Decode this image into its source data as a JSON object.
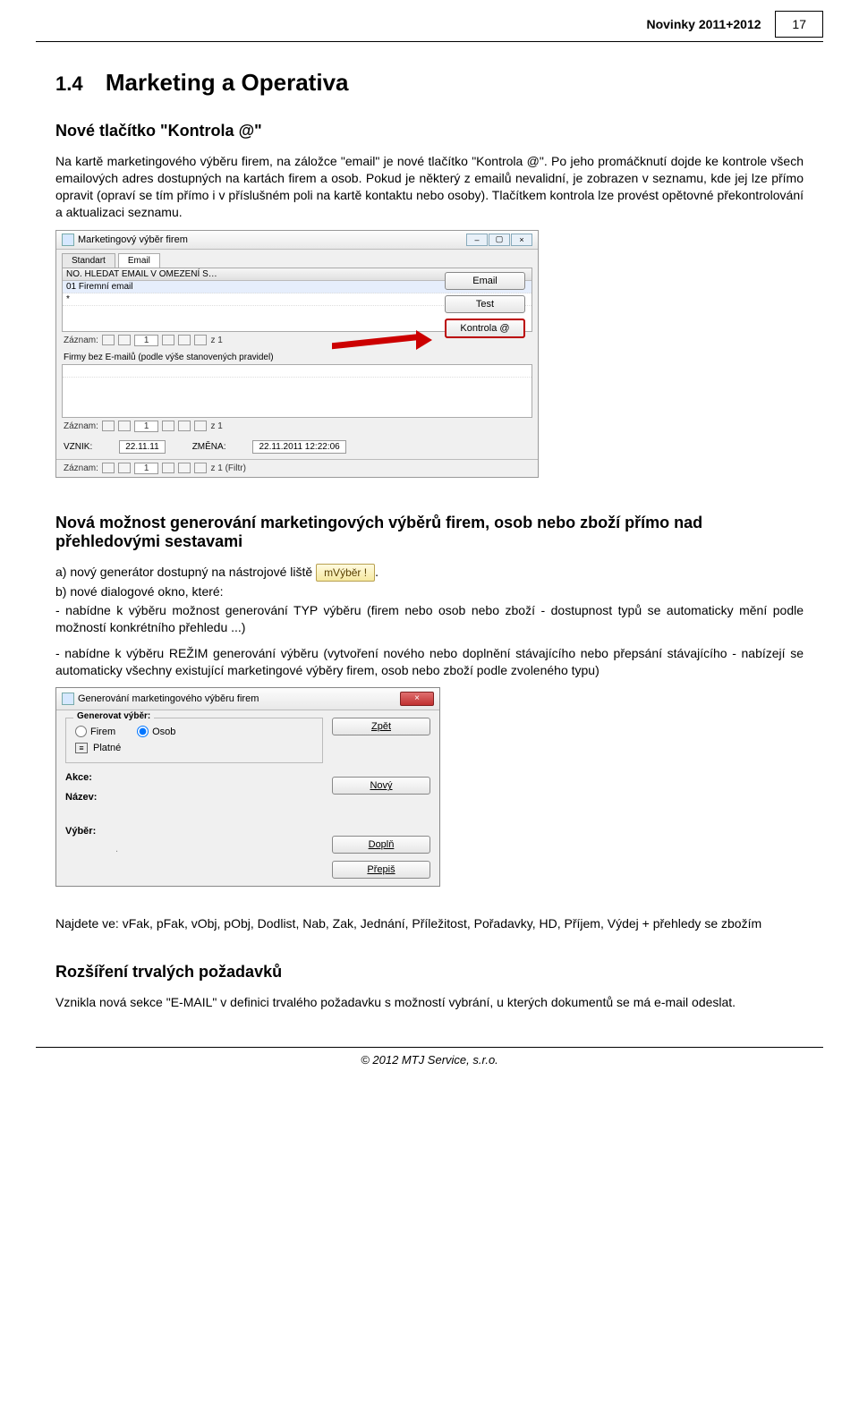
{
  "page": {
    "header_title": "Novinky 2011+2012",
    "number": "17"
  },
  "section": {
    "number": "1.4",
    "title": "Marketing a Operativa"
  },
  "sub1": {
    "title": "Nové tlačítko \"Kontrola @\"",
    "para": "Na kartě marketingového výběru firem, na záložce \"email\" je nové tlačítko \"Kontrola @\". Po jeho promáčknutí dojde ke kontrole všech emailových adres dostupných na kartách firem a osob. Pokud je některý z emailů nevalidní, je zobrazen v seznamu, kde jej lze přímo opravit (opraví se tím přímo i v příslušném poli na kartě kontaktu nebo osoby). Tlačítkem kontrola lze provést opětovné překontrolování a aktualizaci seznamu."
  },
  "shot1": {
    "win_title": "Marketingový výběr firem",
    "tabs": {
      "t1": "Standart",
      "t2": "Email"
    },
    "grid_header": "NO.  HLEDAT EMAIL V        OMEZENÍ                         S…",
    "grid_row": "01    Firemní email",
    "btns": {
      "email": "Email",
      "test": "Test",
      "kontrola": "Kontrola @"
    },
    "rec_label": "Záznam:",
    "rec_pos": "1",
    "rec_of": "z  1",
    "sub_label": "Firmy bez E-mailů (podle výše stanovených pravidel)",
    "vznik_lbl": "VZNIK:",
    "vznik_val": "22.11.11",
    "zmena_lbl": "ZMĚNA:",
    "zmena_val": "22.11.2011 12:22:06",
    "bottom_rec": "z  1 (Filtr)"
  },
  "sub2": {
    "title": "Nová možnost generování marketingových výběrů firem, osob nebo zboží přímo nad přehledovými sestavami",
    "a_line_pre": "a) nový generátor dostupný na nástrojové liště ",
    "mvyber": "mVýběr !",
    "a_line_post": ".",
    "b_line": "b) nové dialogové okno, které:",
    "bullet1": "- nabídne k výběru možnost generování TYP výběru (firem nebo osob nebo zboží - dostupnost typů se automaticky mění podle možností konkrétního přehledu ...)",
    "bullet2": "- nabídne k výběru REŽIM generování výběru (vytvoření nového nebo doplnění stávajícího nebo přepsání stávajícího - nabízejí se automaticky všechny existující marketingové výběry firem, osob nebo zboží podle zvoleného typu)"
  },
  "shot2": {
    "title": "Generování marketingového výběru firem",
    "group_legend": "Generovat výběr:",
    "radio_firem": "Firem",
    "radio_osob": "Osob",
    "platne": "Platné",
    "akce_lbl": "Akce:",
    "nazev_lbl": "Název:",
    "vyber_lbl": "Výběr:",
    "btn_zpet": "Zpět",
    "btn_novy": "Nový",
    "btn_dopln": "Doplň",
    "btn_prepis": "Přepiš"
  },
  "najdete": "Najdete ve: vFak, pFak, vObj, pObj, Dodlist, Nab, Zak, Jednání, Příležitost, Pořadavky, HD, Příjem, Výdej + přehledy se zbožím",
  "sub3": {
    "title": "Rozšíření trvalých požadavků",
    "para": "Vznikla nová sekce \"E-MAIL\" v definici trvalého požadavku s možností vybrání, u kterých dokumentů se má e-mail odeslat."
  },
  "footer": "© 2012 MTJ Service, s.r.o."
}
